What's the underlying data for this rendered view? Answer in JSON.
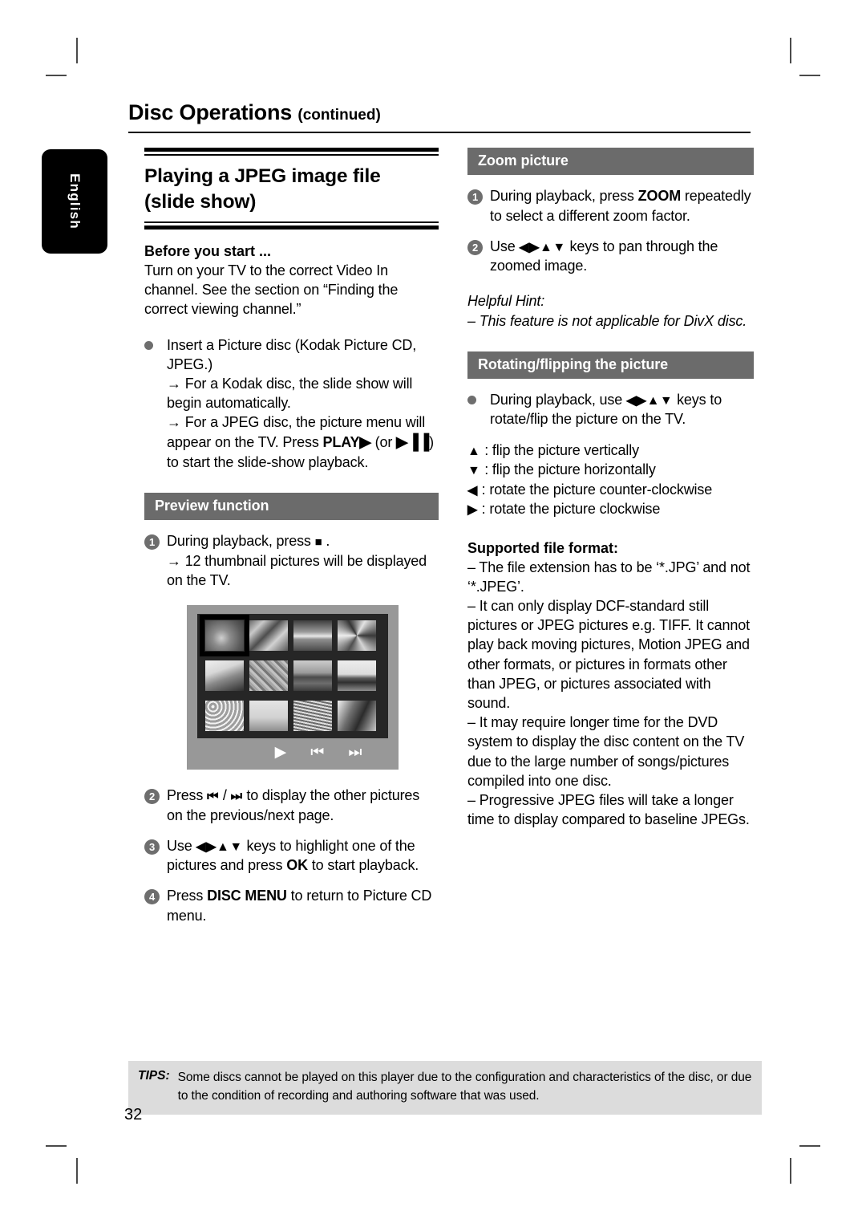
{
  "document": {
    "running_head": "Disc Operations",
    "running_head_suffix": "(continued)",
    "language_tab": "English",
    "page_number": "32"
  },
  "left_column": {
    "section_title_line1": "Playing a JPEG image file",
    "section_title_line2": "(slide show)",
    "before_you_start": {
      "heading": "Before you start ...",
      "body": "Turn on your TV to the correct Video In channel.  See the section on “Finding the correct viewing channel.”"
    },
    "insert_disc": {
      "main": "Insert a Picture disc (Kodak Picture CD, JPEG.)",
      "arrow1": "→  For a Kodak disc, the slide show will begin automatically.",
      "arrow2_a": "→  For a JPEG disc, the picture menu will appear on the TV.  Press ",
      "arrow2_play": "PLAY",
      "arrow2_play_glyph": "▶",
      "arrow2_b": " (or ",
      "arrow2_pauseplay_glyph": "▶▐▐",
      "arrow2_c": ") to start the slide-show playback."
    },
    "preview_function": {
      "bar": "Preview function",
      "step1_a": "During playback, press ",
      "step1_glyph": "■",
      "step1_b": " .",
      "step1_arrow": "→  12 thumbnail pictures will be displayed on the TV.",
      "step2_a": "Press ",
      "step2_prev_glyph": "⏮",
      "step2_sep": " / ",
      "step2_next_glyph": "⏭",
      "step2_b": " to display the other pictures on the previous/next page.",
      "step3_a": "Use ",
      "step3_keys": "◀▶▲▼",
      "step3_b": " keys to highlight one of the pictures and press ",
      "step3_ok": "OK",
      "step3_c": " to start playback.",
      "step4_a": "Press ",
      "step4_menu": "DISC MENU",
      "step4_b": " to return to Picture CD menu."
    },
    "tv_figure": {
      "name": "thumbnail-preview-screen",
      "thumbnail_count": 12,
      "selected_index": 0,
      "controls": [
        "▶",
        "⏮",
        "⏭"
      ]
    }
  },
  "right_column": {
    "zoom_picture": {
      "bar": "Zoom picture",
      "step1_a": "During playback, press ",
      "step1_zoom": "ZOOM",
      "step1_b": " repeatedly to select a different zoom factor.",
      "step2_a": "Use ",
      "step2_keys": "◀▶▲▼",
      "step2_b": " keys to pan through the zoomed image.",
      "hint_label": "Helpful Hint:",
      "hint_text": "–  This feature is not applicable for DivX disc."
    },
    "rotating_flipping": {
      "bar": "Rotating/flipping the picture",
      "bullet_a": "During playback, use ",
      "bullet_keys": "◀▶▲▼",
      "bullet_b": " keys to rotate/flip the picture on the TV.",
      "keys": [
        {
          "glyph": "▲",
          "desc": ": flip the picture vertically"
        },
        {
          "glyph": "▼",
          "desc": ": flip the picture horizontally"
        },
        {
          "glyph": "◀",
          "desc": ": rotate the picture counter-clockwise"
        },
        {
          "glyph": "▶",
          "desc": ": rotate the picture clockwise"
        }
      ]
    },
    "supported_file_format": {
      "heading": "Supported file format:",
      "items": [
        "–  The file extension has to be ‘*.JPG’ and not ‘*.JPEG’.",
        "–  It can only display DCF-standard still pictures or JPEG pictures e.g. TIFF.  It cannot play back moving pictures, Motion JPEG and other formats, or pictures in formats other than JPEG, or pictures associated with sound.",
        "–  It may require longer time for the DVD system to display the disc content on the TV due to the large number of songs/pictures compiled into one disc.",
        "–  Progressive JPEG files will take a longer time to display compared to baseline JPEGs."
      ]
    }
  },
  "footer": {
    "tips_label": "TIPS:",
    "tips_text": "Some discs cannot be played on this player due to the configuration and characteristics of the disc, or due to the condition of recording and authoring software that was used."
  },
  "colors": {
    "bar_gray": "#6b6b6b",
    "badge_gray": "#6e6e6e",
    "tips_gray": "#dcdcdc",
    "tv_bezel": "#989898",
    "tv_screen": "#262626"
  }
}
